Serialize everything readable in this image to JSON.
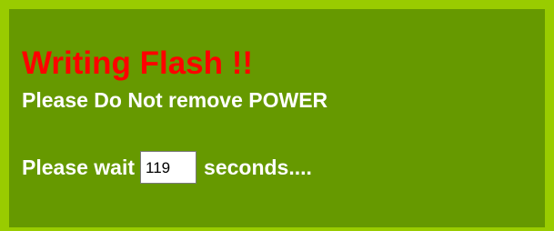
{
  "panel": {
    "title": "Writing Flash !!",
    "warning": "Please Do Not remove POWER",
    "wait_prefix": "Please wait",
    "countdown_value": "119",
    "wait_suffix": "seconds...."
  },
  "colors": {
    "panel_background": "#669900",
    "panel_border": "#99cc00",
    "title_text": "#ff0000",
    "body_text": "#ffffff"
  }
}
